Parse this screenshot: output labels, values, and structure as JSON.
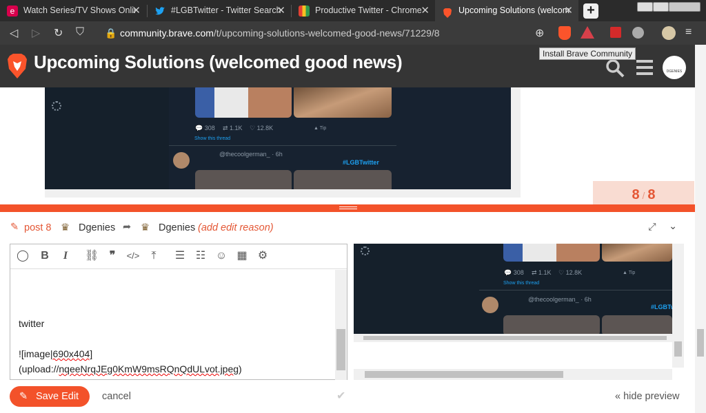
{
  "tabs": [
    {
      "label": "Watch Series/TV Shows Onlin",
      "icon": "e-site-icon",
      "icon_color": "#d8004c"
    },
    {
      "label": "#LGBTwitter - Twitter Search",
      "icon": "twitter-icon",
      "icon_color": "#1da1f2"
    },
    {
      "label": "Productive Twitter - Chrome",
      "icon": "chrome-store-icon",
      "icon_color": "#e8b43b"
    },
    {
      "label": "Upcoming Solutions (welcom",
      "icon": "brave-icon",
      "icon_color": "#fb542b"
    }
  ],
  "new_tab_label": "+",
  "address": {
    "domain": "community.brave.com",
    "path": "/t/upcoming-solutions-welcomed-good-news/71229/8"
  },
  "tooltip": "Install Brave Community",
  "site": {
    "title": "Upcoming Solutions (welcomed good news)",
    "avatar_label": "DGENIES"
  },
  "embedded": {
    "reply_count": "308",
    "retweet_count": "1.1K",
    "like_count": "12.8K",
    "tip_label": "Tip",
    "show_thread": "Show this thread",
    "handle": "@thecoolgerman_",
    "time": "· 6h",
    "hashtag": "#LGBTwitter"
  },
  "progress": {
    "current": "8",
    "total": "8",
    "sep": "/"
  },
  "composer": {
    "post_label": "post 8",
    "user1": "Dgenies",
    "user2": "Dgenies",
    "edit_reason": "(add edit reason)"
  },
  "editor": {
    "line1": "twitter",
    "line2a": "![image",
    "line2b": "|690x404]",
    "line3a": "(upload://",
    "line3b": "nqeeNrqJEg0KmW9msRQnQdULvot.jpeg",
    "line3c": ")"
  },
  "preview": {
    "reply_count": "308",
    "retweet_count": "1.1K",
    "like_count": "12.8K",
    "tip_label": "Tip",
    "show_thread": "Show this thread",
    "handle": "@thecoolgerman_",
    "time": "· 6h",
    "hashtag": "#LGBTw"
  },
  "actions": {
    "save": "Save Edit",
    "cancel": "cancel",
    "hide_preview": "« hide preview"
  },
  "colors": {
    "accent": "#f3522a",
    "header_bg": "#353535",
    "tweet_bg": "#172230"
  }
}
